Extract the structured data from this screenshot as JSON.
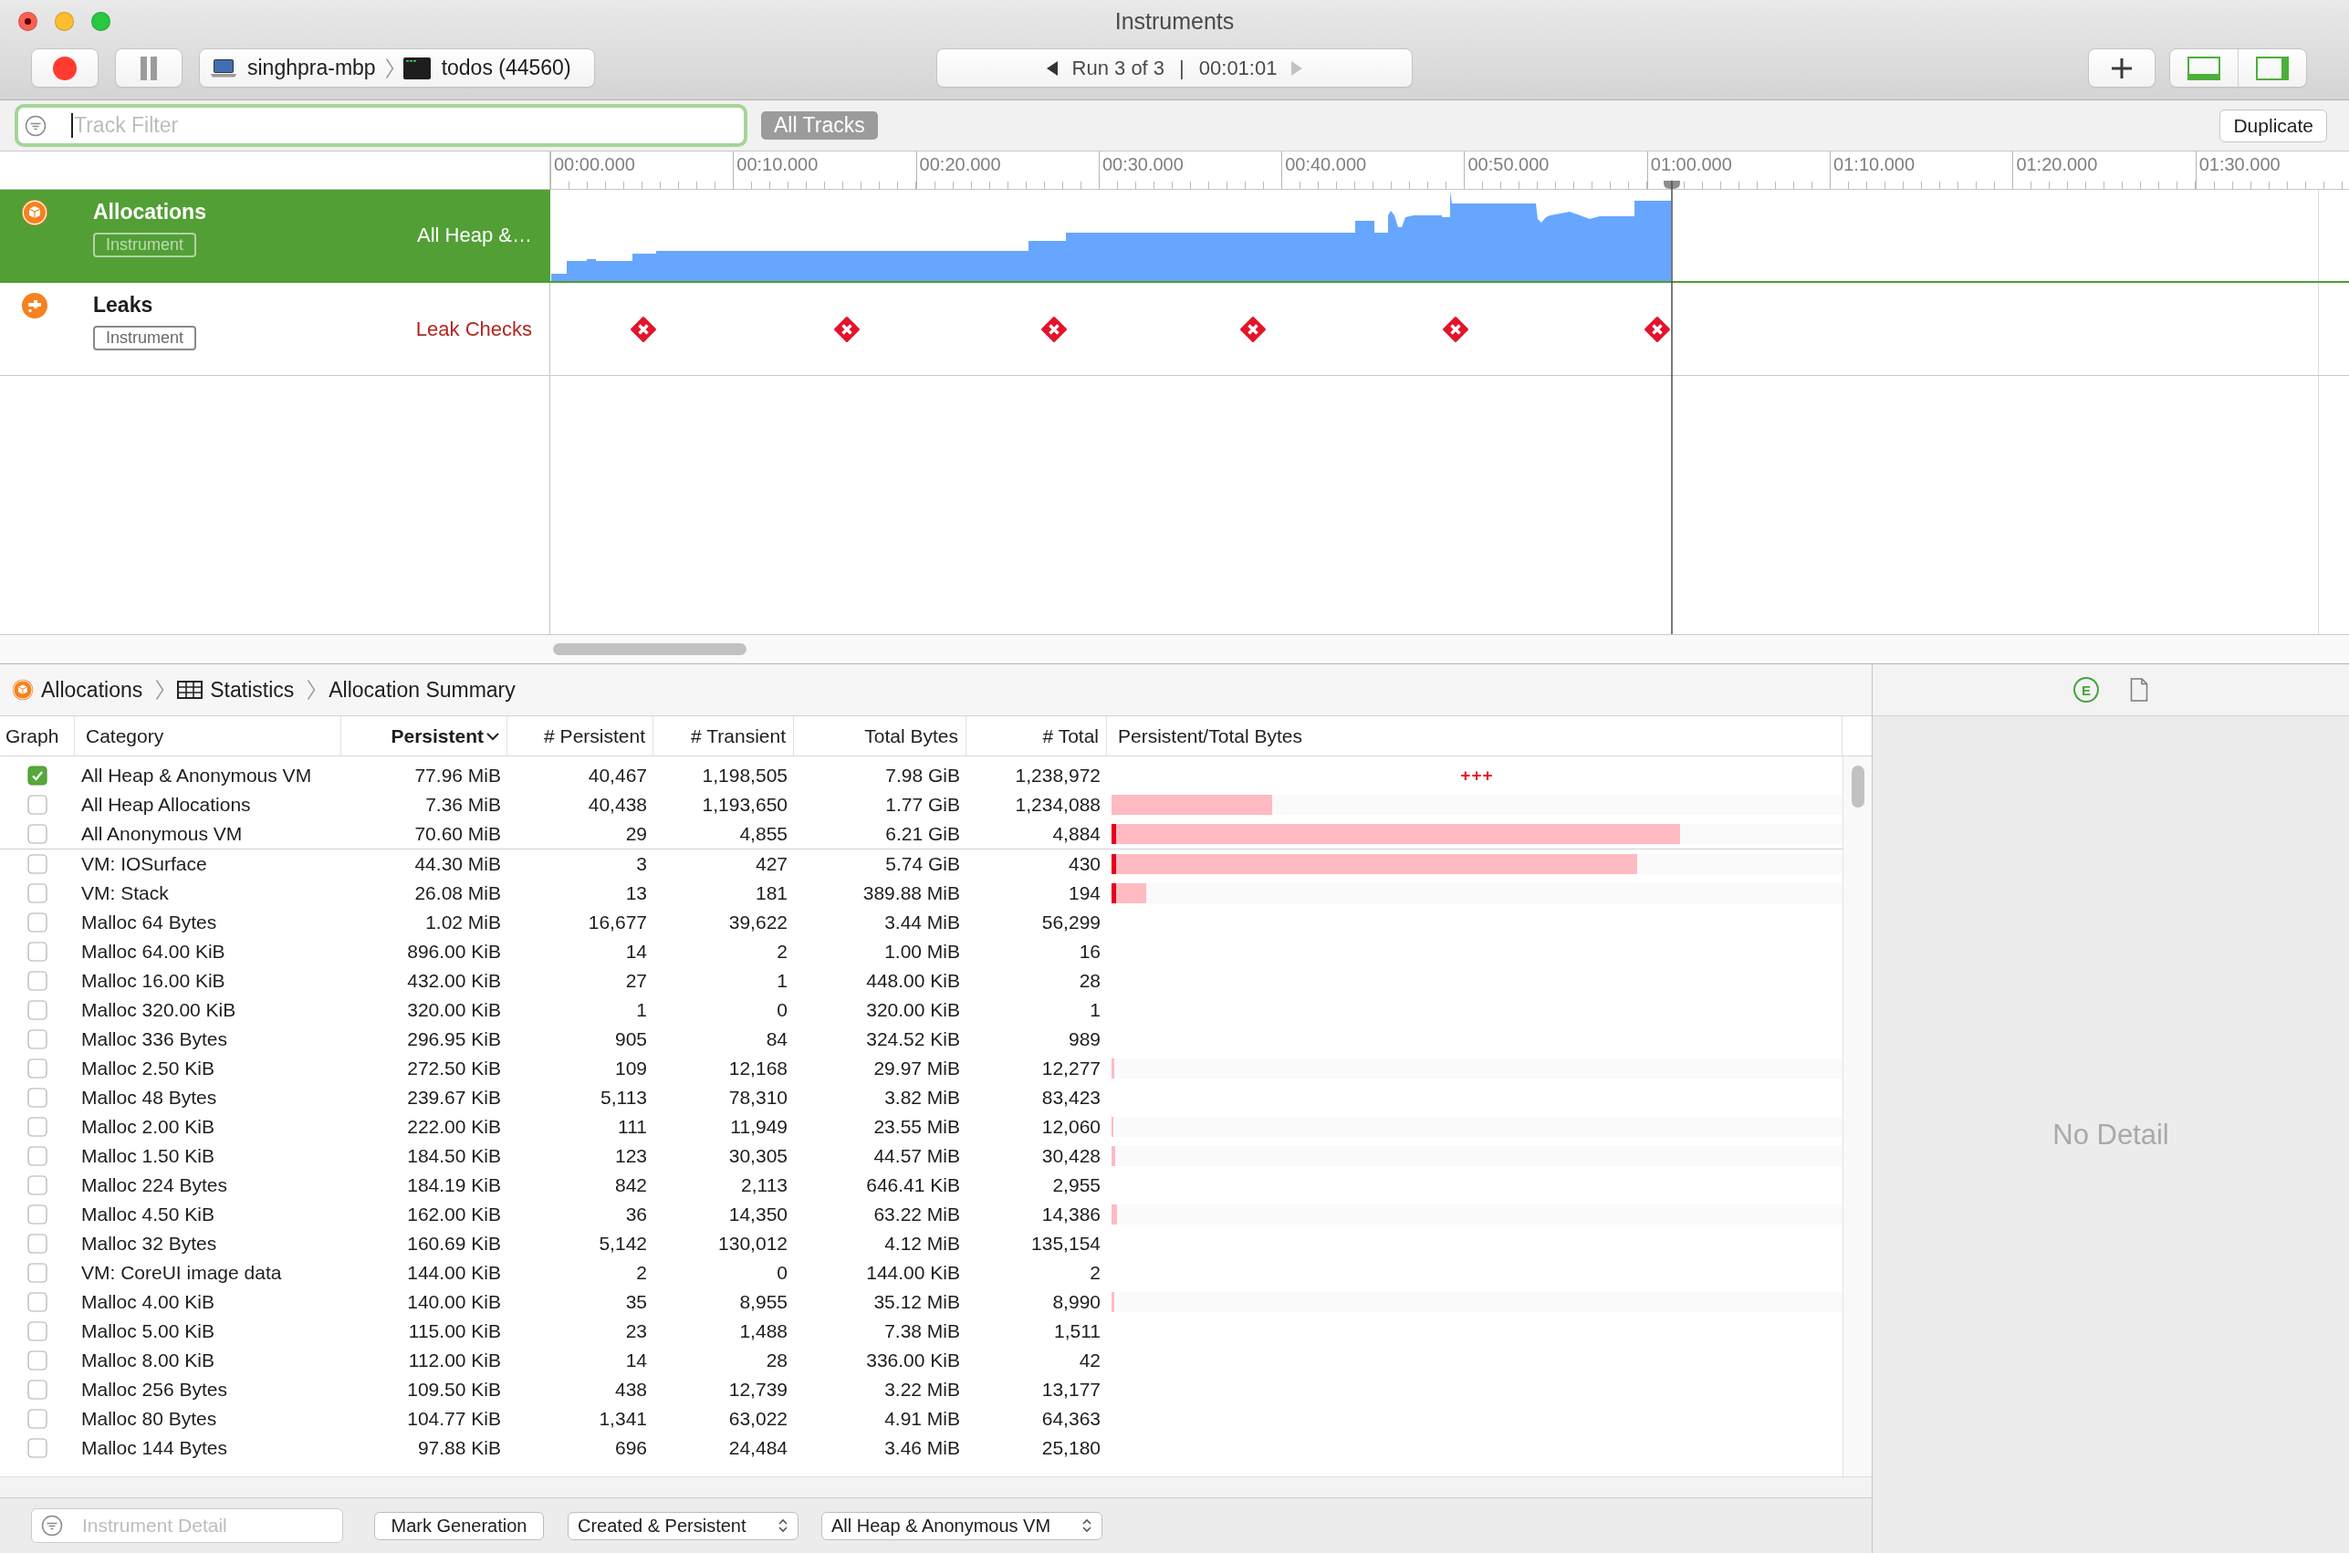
{
  "window": {
    "title": "Instruments"
  },
  "toolbar": {
    "target": {
      "device": "singhpra-mbp",
      "process": "todos (44560)"
    },
    "run_navigator": {
      "previous_disabled": false,
      "run": "Run 3 of 3",
      "separator": "|",
      "time": "00:01:01",
      "next_disabled": true
    },
    "layout_toggles": [
      {
        "kind": "bottom_panel",
        "selected": true
      },
      {
        "kind": "right_panel",
        "selected": true
      }
    ]
  },
  "filter_bar": {
    "track_filter": {
      "placeholder": "Track Filter",
      "focused": true
    },
    "scope": "All Tracks",
    "duplicate": "Duplicate"
  },
  "timeline": {
    "ticks": [
      "00:00.000",
      "00:10.000",
      "00:20.000",
      "00:30.000",
      "00:40.000",
      "00:50.000",
      "01:00.000",
      "01:10.000",
      "01:20.000",
      "01:30.000"
    ]
  },
  "tracks": [
    {
      "kind": "allocations",
      "name": "Allocations",
      "badge": "Instrument",
      "detail": "All Heap &…",
      "selected": true
    },
    {
      "kind": "leaks",
      "name": "Leaks",
      "badge": "Instrument",
      "detail": "Leak Checks",
      "selected": false
    }
  ],
  "breadcrumbs": [
    {
      "kind": "instrument",
      "label": "Allocations"
    },
    {
      "kind": "view",
      "label": "Statistics"
    },
    {
      "kind": "plain",
      "label": "Allocation Summary"
    }
  ],
  "detail_panel": {
    "tabs": [
      {
        "kind": "extended",
        "label": "E",
        "selected": true
      },
      {
        "kind": "document",
        "selected": false
      }
    ],
    "empty_text": "No Detail"
  },
  "table": {
    "columns": [
      {
        "label": "Graph",
        "sorted": false
      },
      {
        "label": "Category",
        "sorted": false
      },
      {
        "label": "Persistent",
        "sorted": true
      },
      {
        "label": "# Persistent",
        "sorted": false
      },
      {
        "label": "# Transient",
        "sorted": false
      },
      {
        "label": "Total Bytes",
        "sorted": false
      },
      {
        "label": "# Total",
        "sorted": false
      },
      {
        "label": "Persistent/Total Bytes",
        "sorted": false
      }
    ],
    "summary_rows": [
      {
        "checked": true,
        "cells": [
          "",
          "All Heap & Anonymous VM",
          "77.96 MiB",
          "40,467",
          "1,198,505",
          "7.98 GiB",
          "1,238,972",
          "+++"
        ],
        "persistent_marker": false
      },
      {
        "checked": false,
        "cells": [
          "",
          "All Heap Allocations",
          "7.36 MiB",
          "40,438",
          "1,193,650",
          "1.77 GiB",
          "1,234,088"
        ],
        "persistent_marker": false,
        "level": 0.22
      },
      {
        "checked": false,
        "cells": [
          "",
          "All Anonymous VM",
          "70.60 MiB",
          "29",
          "4,855",
          "6.21 GiB",
          "4,884"
        ],
        "persistent_marker": true,
        "level": 0.778
      }
    ],
    "rows": [
      {
        "checked": false,
        "cells": [
          "",
          "VM: IOSurface",
          "44.30 MiB",
          "3",
          "427",
          "5.74 GiB",
          "430"
        ],
        "persistent_marker": true,
        "level": 0.719
      },
      {
        "checked": false,
        "cells": [
          "",
          "VM: Stack",
          "26.08 MiB",
          "13",
          "181",
          "389.88 MiB",
          "194"
        ],
        "persistent_marker": true,
        "level": 0.048
      },
      {
        "checked": false,
        "cells": [
          "",
          "Malloc 64 Bytes",
          "1.02 MiB",
          "16,677",
          "39,622",
          "3.44 MiB",
          "56,299"
        ],
        "persistent_marker": false
      },
      {
        "checked": false,
        "cells": [
          "",
          "Malloc 64.00 KiB",
          "896.00 KiB",
          "14",
          "2",
          "1.00 MiB",
          "16"
        ],
        "persistent_marker": false
      },
      {
        "checked": false,
        "cells": [
          "",
          "Malloc 16.00 KiB",
          "432.00 KiB",
          "27",
          "1",
          "448.00 KiB",
          "28"
        ],
        "persistent_marker": false
      },
      {
        "checked": false,
        "cells": [
          "",
          "Malloc 320.00 KiB",
          "320.00 KiB",
          "1",
          "0",
          "320.00 KiB",
          "1"
        ],
        "persistent_marker": false
      },
      {
        "checked": false,
        "cells": [
          "",
          "Malloc 336 Bytes",
          "296.95 KiB",
          "905",
          "84",
          "324.52 KiB",
          "989"
        ],
        "persistent_marker": false
      },
      {
        "checked": false,
        "cells": [
          "",
          "Malloc 2.50 KiB",
          "272.50 KiB",
          "109",
          "12,168",
          "29.97 MiB",
          "12,277"
        ],
        "persistent_marker": false,
        "level": 0.004
      },
      {
        "checked": false,
        "cells": [
          "",
          "Malloc 48 Bytes",
          "239.67 KiB",
          "5,113",
          "78,310",
          "3.82 MiB",
          "83,423"
        ],
        "persistent_marker": false
      },
      {
        "checked": false,
        "cells": [
          "",
          "Malloc 2.00 KiB",
          "222.00 KiB",
          "111",
          "11,949",
          "23.55 MiB",
          "12,060"
        ],
        "persistent_marker": false,
        "level": 0.003
      },
      {
        "checked": false,
        "cells": [
          "",
          "Malloc 1.50 KiB",
          "184.50 KiB",
          "123",
          "30,305",
          "44.57 MiB",
          "30,428"
        ],
        "persistent_marker": false,
        "level": 0.005
      },
      {
        "checked": false,
        "cells": [
          "",
          "Malloc 224 Bytes",
          "184.19 KiB",
          "842",
          "2,113",
          "646.41 KiB",
          "2,955"
        ],
        "persistent_marker": false
      },
      {
        "checked": false,
        "cells": [
          "",
          "Malloc 4.50 KiB",
          "162.00 KiB",
          "36",
          "14,350",
          "63.22 MiB",
          "14,386"
        ],
        "persistent_marker": false,
        "level": 0.007
      },
      {
        "checked": false,
        "cells": [
          "",
          "Malloc 32 Bytes",
          "160.69 KiB",
          "5,142",
          "130,012",
          "4.12 MiB",
          "135,154"
        ],
        "persistent_marker": false
      },
      {
        "checked": false,
        "cells": [
          "",
          "VM: CoreUI image data",
          "144.00 KiB",
          "2",
          "0",
          "144.00 KiB",
          "2"
        ],
        "persistent_marker": false
      },
      {
        "checked": false,
        "cells": [
          "",
          "Malloc 4.00 KiB",
          "140.00 KiB",
          "35",
          "8,955",
          "35.12 MiB",
          "8,990"
        ],
        "persistent_marker": false,
        "level": 0.004
      },
      {
        "checked": false,
        "cells": [
          "",
          "Malloc 5.00 KiB",
          "115.00 KiB",
          "23",
          "1,488",
          "7.38 MiB",
          "1,511"
        ],
        "persistent_marker": false
      },
      {
        "checked": false,
        "cells": [
          "",
          "Malloc 8.00 KiB",
          "112.00 KiB",
          "14",
          "28",
          "336.00 KiB",
          "42"
        ],
        "persistent_marker": false
      },
      {
        "checked": false,
        "cells": [
          "",
          "Malloc 256 Bytes",
          "109.50 KiB",
          "438",
          "12,739",
          "3.22 MiB",
          "13,177"
        ],
        "persistent_marker": false
      },
      {
        "checked": false,
        "cells": [
          "",
          "Malloc 80 Bytes",
          "104.77 KiB",
          "1,341",
          "63,022",
          "4.91 MiB",
          "64,363"
        ],
        "persistent_marker": false
      },
      {
        "checked": false,
        "cells": [
          "",
          "Malloc 144 Bytes",
          "97.88 KiB",
          "696",
          "24,484",
          "3.46 MiB",
          "25,180"
        ],
        "persistent_marker": false
      }
    ]
  },
  "bottom_bar": {
    "detail_filter": {
      "placeholder": "Instrument Detail"
    },
    "mark_button": "Mark Generation",
    "popups": [
      "Created & Persistent",
      "All Heap & Anonymous VM"
    ]
  }
}
